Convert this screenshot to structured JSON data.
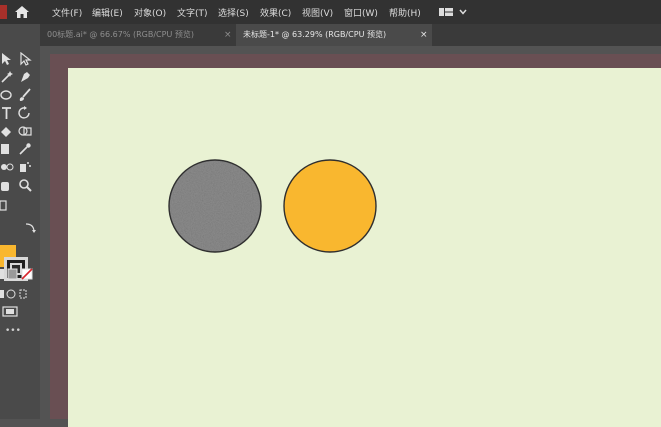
{
  "menu": {
    "items": [
      {
        "label": "文件(F)"
      },
      {
        "label": "编辑(E)"
      },
      {
        "label": "对象(O)"
      },
      {
        "label": "文字(T)"
      },
      {
        "label": "选择(S)"
      },
      {
        "label": "效果(C)"
      },
      {
        "label": "视图(V)"
      },
      {
        "label": "窗口(W)"
      },
      {
        "label": "帮助(H)"
      }
    ]
  },
  "tabs": [
    {
      "label": "00标题.ai* @ 66.67% (RGB/CPU 预览)",
      "close": "×",
      "active": false
    },
    {
      "label": "未标题-1* @ 63.29% (RGB/CPU 预览)",
      "close": "×",
      "active": true
    }
  ],
  "toolbar": {
    "fill_color": "#f9b72f",
    "stroke_color": "#1f1f1f",
    "more_tools": "•••"
  },
  "artwork": {
    "background": "#e9f2d3",
    "circles": [
      {
        "name": "textured-gray-circle",
        "fill": "#8d8d8d",
        "texture": "concrete"
      },
      {
        "name": "orange-circle",
        "fill": "#f9b72f"
      }
    ]
  }
}
